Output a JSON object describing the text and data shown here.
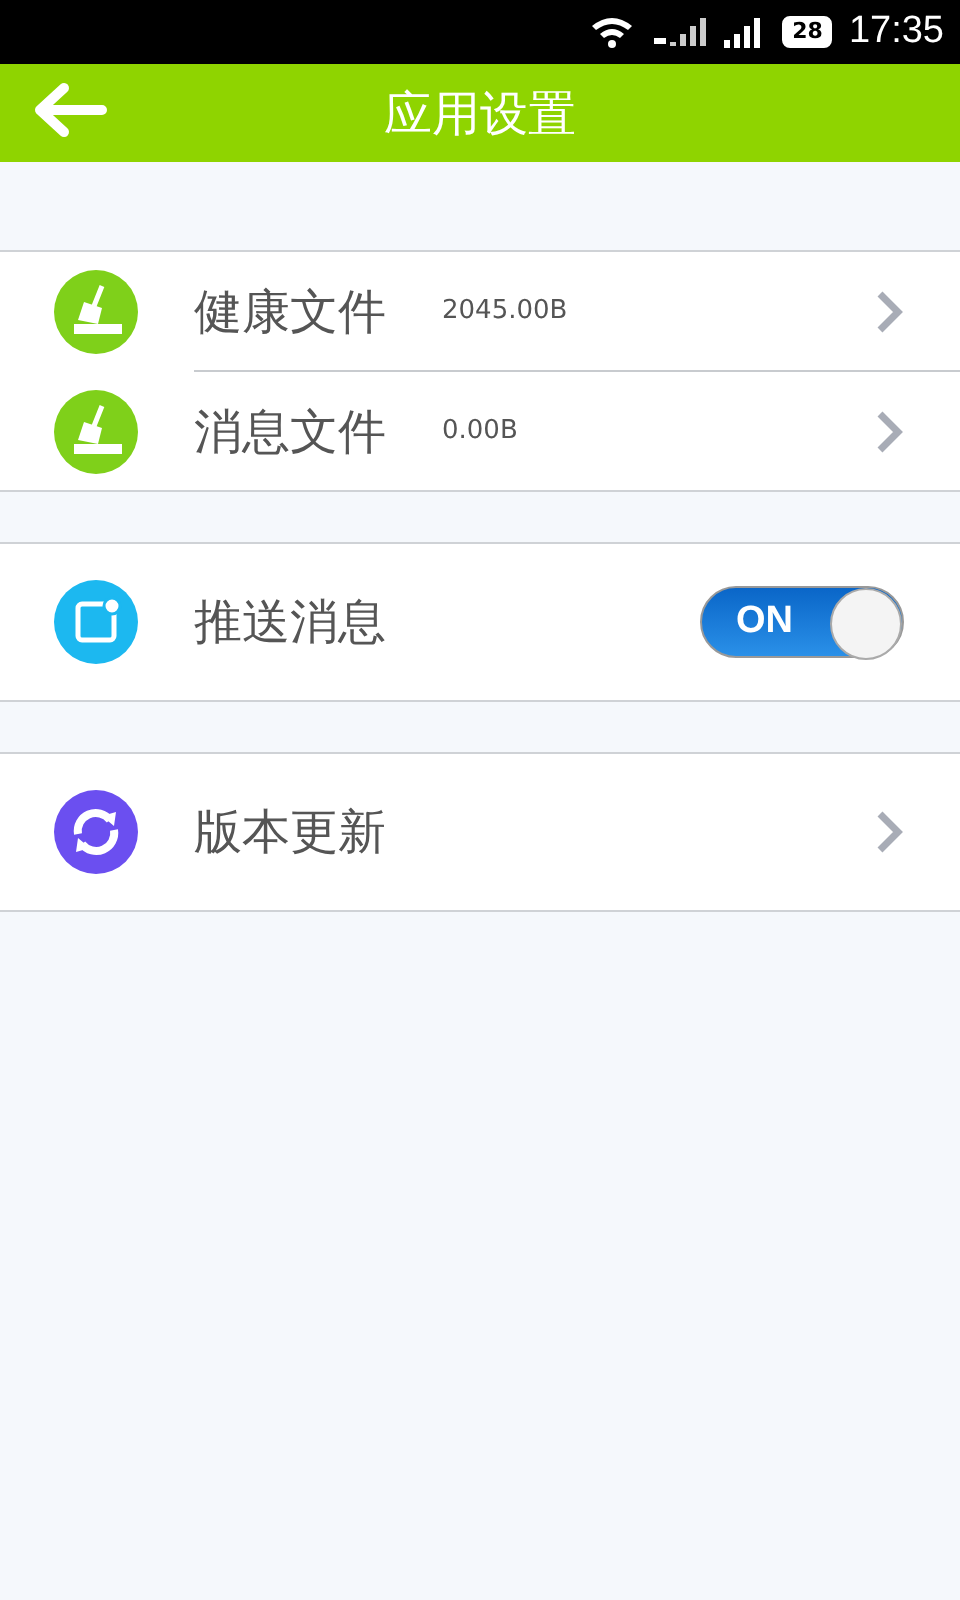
{
  "status_bar": {
    "battery": "28",
    "time": "17:35"
  },
  "header": {
    "title": "应用设置"
  },
  "groups": [
    {
      "items": [
        {
          "kind": "link",
          "label": "健康文件",
          "value": "2045.00B"
        },
        {
          "kind": "link",
          "label": "消息文件",
          "value": "0.00B"
        }
      ]
    },
    {
      "items": [
        {
          "kind": "toggle",
          "label": "推送消息",
          "on": true,
          "toggle_label": "ON"
        }
      ]
    },
    {
      "items": [
        {
          "kind": "link",
          "label": "版本更新"
        }
      ]
    }
  ]
}
